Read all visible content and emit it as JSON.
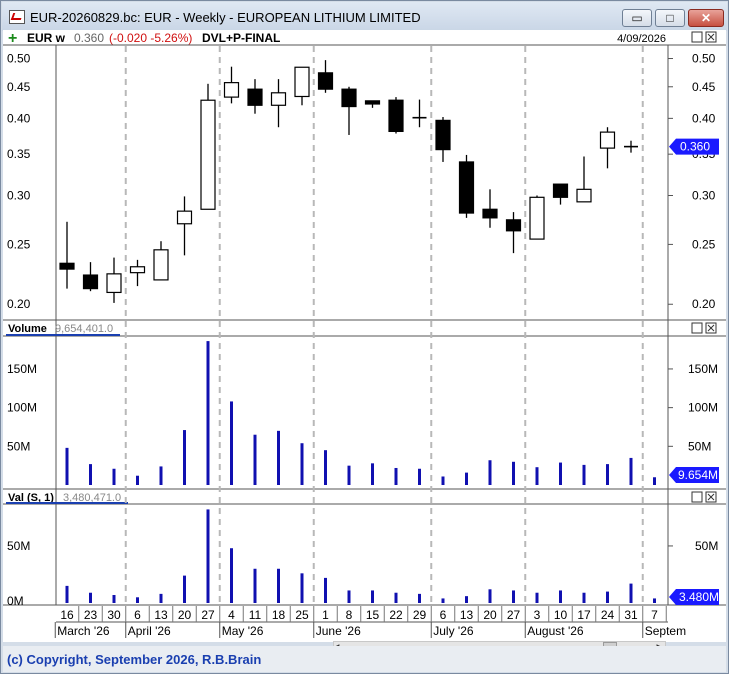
{
  "window": {
    "title": "EUR-20260829.bc: EUR - Weekly - EUROPEAN LITHIUM LIMITED",
    "minimize_label": "▭",
    "maximize_label": "□",
    "close_label": "✕"
  },
  "header": {
    "plus": "+",
    "symbol": "EUR w",
    "last": "0.360",
    "change": "(-0.020 -5.26%)",
    "study": "DVL+P-FINAL",
    "date": "4/09/2026"
  },
  "panels": {
    "volume_label": "Volume",
    "volume_value": "9,654,401.0",
    "val_label": "Val (S, 1)",
    "val_value": "3,480,471.0"
  },
  "colors": {
    "accent": "#1a3fb0",
    "volume_bar": "#1010b0",
    "change_red": "#d01010",
    "grid_dash": "#b8b8b8"
  },
  "chart_data": [
    {
      "type": "candlestick",
      "scale": "log",
      "ylim": [
        0.19,
        0.52
      ],
      "yticks": [
        "0.50",
        "0.45",
        "0.40",
        "0.35",
        "0.30",
        "0.25",
        "0.20"
      ],
      "ytick_values": [
        0.5,
        0.45,
        0.4,
        0.35,
        0.3,
        0.25,
        0.2
      ],
      "last_label": "0.360",
      "last_value": 0.36,
      "x": [
        "16",
        "23",
        "30",
        "6",
        "13",
        "20",
        "27",
        "4",
        "11",
        "18",
        "25",
        "1",
        "8",
        "15",
        "22",
        "29",
        "6",
        "13",
        "20",
        "27",
        "3",
        "10",
        "17",
        "24",
        "31",
        "7"
      ],
      "months": [
        {
          "label": "March '26",
          "index": 0
        },
        {
          "label": "April '26",
          "index": 3
        },
        {
          "label": "May '26",
          "index": 7
        },
        {
          "label": "June '26",
          "index": 11
        },
        {
          "label": "July '26",
          "index": 16
        },
        {
          "label": "August '26",
          "index": 20
        },
        {
          "label": "Septem",
          "index": 25
        }
      ],
      "month_lines": [
        3,
        7,
        11,
        16,
        20,
        25
      ],
      "candles": [
        {
          "o": 0.233,
          "h": 0.272,
          "l": 0.212,
          "c": 0.228
        },
        {
          "o": 0.223,
          "h": 0.234,
          "l": 0.21,
          "c": 0.212
        },
        {
          "o": 0.209,
          "h": 0.238,
          "l": 0.201,
          "c": 0.224
        },
        {
          "o": 0.225,
          "h": 0.236,
          "l": 0.214,
          "c": 0.23
        },
        {
          "o": 0.219,
          "h": 0.253,
          "l": 0.219,
          "c": 0.245
        },
        {
          "o": 0.27,
          "h": 0.299,
          "l": 0.24,
          "c": 0.283
        },
        {
          "o": 0.285,
          "h": 0.455,
          "l": 0.285,
          "c": 0.428
        },
        {
          "o": 0.433,
          "h": 0.485,
          "l": 0.423,
          "c": 0.457
        },
        {
          "o": 0.446,
          "h": 0.463,
          "l": 0.407,
          "c": 0.42
        },
        {
          "o": 0.42,
          "h": 0.463,
          "l": 0.387,
          "c": 0.44
        },
        {
          "o": 0.434,
          "h": 0.484,
          "l": 0.42,
          "c": 0.484
        },
        {
          "o": 0.474,
          "h": 0.497,
          "l": 0.44,
          "c": 0.446
        },
        {
          "o": 0.446,
          "h": 0.45,
          "l": 0.376,
          "c": 0.418
        },
        {
          "o": 0.427,
          "h": 0.427,
          "l": 0.416,
          "c": 0.422
        },
        {
          "o": 0.428,
          "h": 0.433,
          "l": 0.378,
          "c": 0.381
        },
        {
          "o": 0.401,
          "h": 0.429,
          "l": 0.387,
          "c": 0.401
        },
        {
          "o": 0.397,
          "h": 0.402,
          "l": 0.34,
          "c": 0.356
        },
        {
          "o": 0.34,
          "h": 0.349,
          "l": 0.276,
          "c": 0.281
        },
        {
          "o": 0.285,
          "h": 0.307,
          "l": 0.266,
          "c": 0.276
        },
        {
          "o": 0.274,
          "h": 0.282,
          "l": 0.242,
          "c": 0.263
        },
        {
          "o": 0.255,
          "h": 0.3,
          "l": 0.255,
          "c": 0.298
        },
        {
          "o": 0.313,
          "h": 0.313,
          "l": 0.29,
          "c": 0.298
        },
        {
          "o": 0.293,
          "h": 0.347,
          "l": 0.293,
          "c": 0.307
        },
        {
          "o": 0.358,
          "h": 0.387,
          "l": 0.332,
          "c": 0.38
        },
        {
          "o": 0.36,
          "h": 0.368,
          "l": 0.352,
          "c": 0.36
        }
      ]
    },
    {
      "type": "bar",
      "title": "Volume",
      "ylim": [
        0,
        190
      ],
      "yticks": [
        "150M",
        "100M",
        "50M"
      ],
      "ytick_values": [
        150,
        100,
        50
      ],
      "last_label": "9.654M",
      "values": [
        48,
        27,
        21,
        12,
        24,
        71,
        186,
        108,
        65,
        70,
        54,
        45,
        25,
        28,
        22,
        21,
        11,
        16,
        32,
        30,
        23,
        29,
        26,
        27,
        35,
        10
      ]
    },
    {
      "type": "bar",
      "title": "Val (S, 1)",
      "ylim": [
        0,
        85
      ],
      "yticks": [
        "50M",
        "0M"
      ],
      "ytick_values": [
        50,
        0
      ],
      "last_label": "3.480M",
      "values": [
        15,
        9,
        7,
        5,
        8,
        24,
        82,
        48,
        30,
        30,
        26,
        22,
        11,
        11,
        9,
        8,
        4,
        6,
        12,
        11,
        9,
        11,
        9,
        10,
        17,
        4
      ]
    }
  ]
}
